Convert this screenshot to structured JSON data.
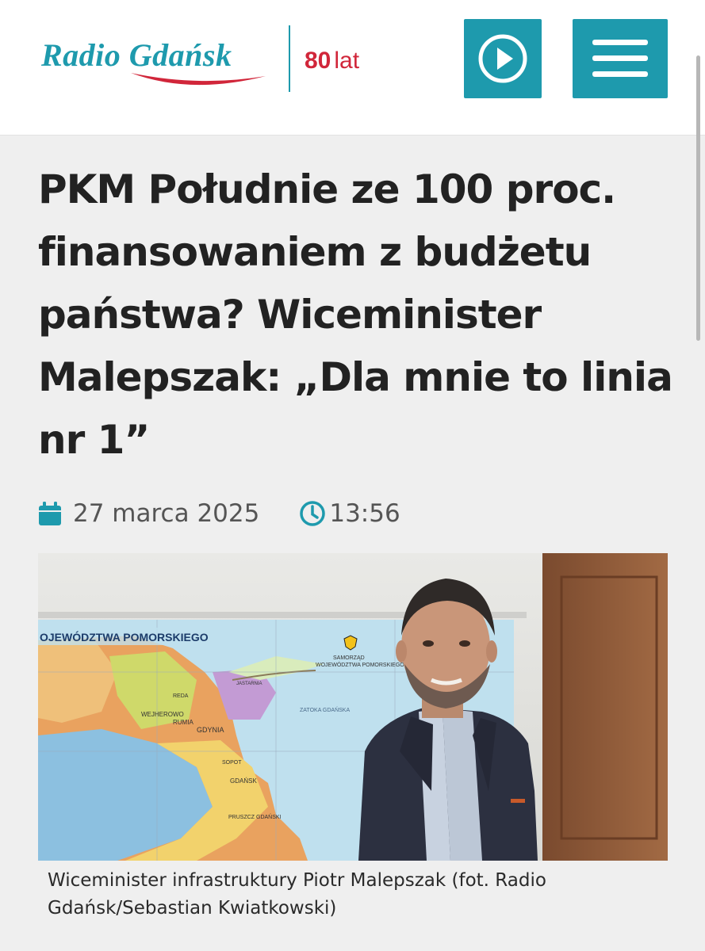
{
  "header": {
    "logo_text": "Radio Gdańsk",
    "anniversary_number": "80",
    "anniversary_word": "lat",
    "play_button_icon": "play-circle-icon",
    "menu_button_icon": "hamburger-menu-icon",
    "accent_color": "#1e9aad",
    "brand_red": "#d1263a"
  },
  "article": {
    "title": "PKM Południe ze 100 proc. finansowaniem z budżetu państwa? Wiceminister Malepszak: „Dla mnie to linia nr 1”",
    "date": "27 marca 2025",
    "time": "13:56",
    "date_icon": "calendar-icon",
    "time_icon": "clock-icon",
    "photo": {
      "map_label": "OJEWÓDZTWA POMORSKIEGO",
      "seal_text_1": "SAMORZĄD",
      "seal_text_2": "WOJEWÓDZTWA POMORSKIEGO",
      "map_places": [
        "WEJHEROWO",
        "RUMIA",
        "GDYNIA",
        "SOPOT",
        "GDAŃSK",
        "PRUSZCZ GDAŃSKI",
        "REDA",
        "JASTARNIA",
        "ZATOKA GDAŃSKA"
      ]
    },
    "caption": "Wiceminister infrastruktury Piotr Malepszak (fot. Radio Gdańsk/Sebastian Kwiatkowski)"
  }
}
